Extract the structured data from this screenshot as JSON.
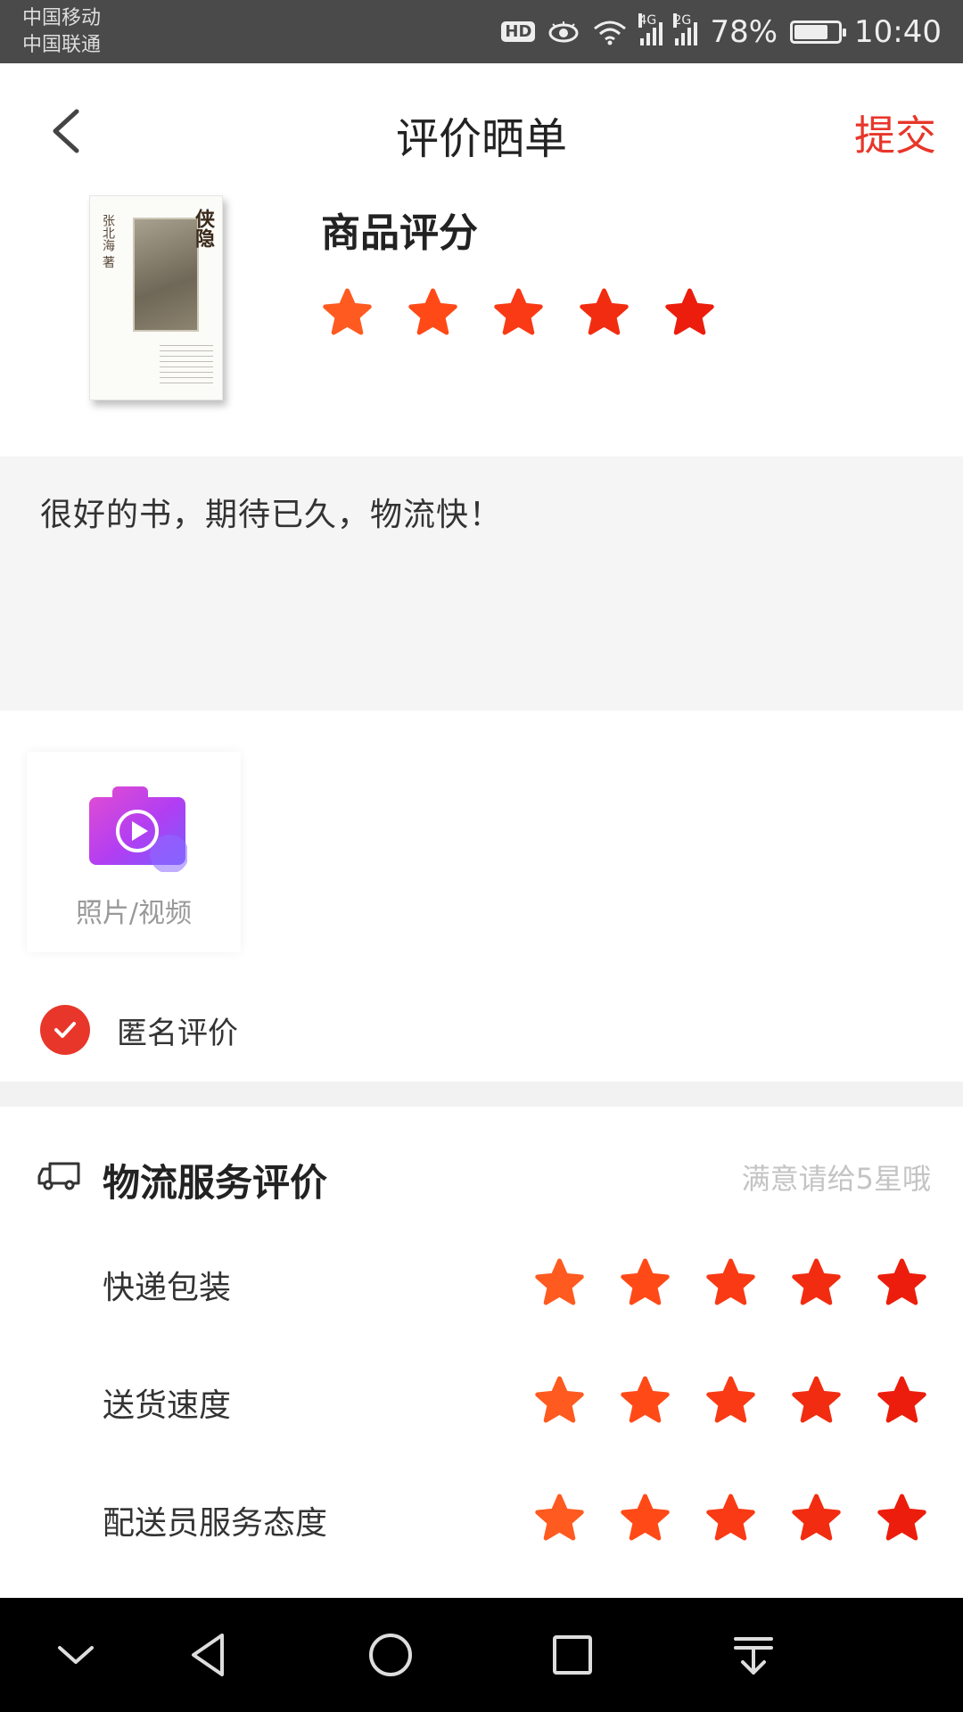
{
  "status_bar": {
    "carriers": [
      "中国移动",
      "中国联通"
    ],
    "hd": "HD",
    "net1": "4G",
    "net2": "2G",
    "battery_pct": "78%",
    "battery_level": 0.78,
    "time": "10:40"
  },
  "header": {
    "title": "评价晒单",
    "submit_label": "提交"
  },
  "product": {
    "rating_label": "商品评分",
    "rating": 5,
    "max_rating": 5,
    "cover_title": "侠隐"
  },
  "comment": {
    "text": "很好的书，期待已久，物流快！"
  },
  "upload": {
    "label": "照片/视频"
  },
  "anonymous": {
    "label": "匿名评价",
    "checked": true
  },
  "logistics": {
    "title": "物流服务评价",
    "hint": "满意请给5星哦",
    "rows": [
      {
        "label": "快递包装",
        "rating": 5
      },
      {
        "label": "送货速度",
        "rating": 5
      },
      {
        "label": "配送员服务态度",
        "rating": 5
      }
    ]
  },
  "colors": {
    "accent": "#e8362a",
    "star_gradient": [
      "#ff5a1f",
      "#ff4a18",
      "#f93a14",
      "#f22c10",
      "#ec1d0c"
    ]
  }
}
